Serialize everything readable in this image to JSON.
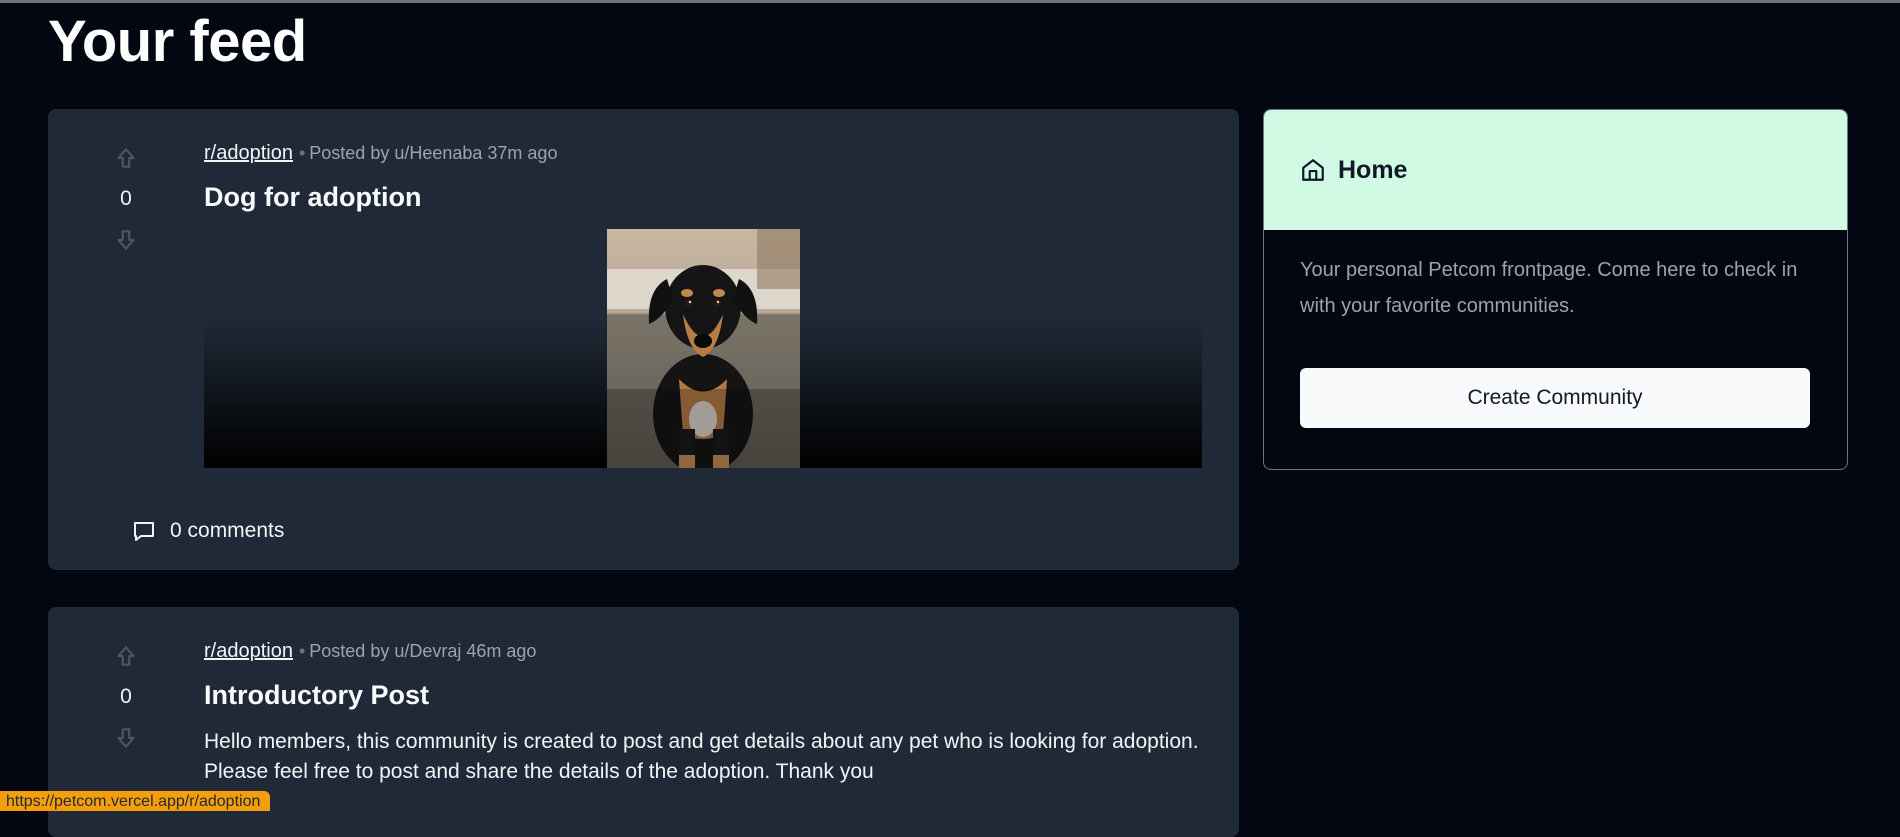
{
  "page": {
    "title": "Your feed"
  },
  "posts": [
    {
      "votes": "0",
      "subreddit": "r/adoption",
      "meta": "Posted by u/Heenaba 37m ago",
      "title": "Dog for adoption",
      "has_image": true,
      "comments": "0 comments"
    },
    {
      "votes": "0",
      "subreddit": "r/adoption",
      "meta": "Posted by u/Devraj 46m ago",
      "title": "Introductory Post",
      "body": "Hello members, this community is created to post and get details about any pet who is looking for adoption. Please feel free to post and share the details of the adoption. Thank you"
    }
  ],
  "sidebar": {
    "title": "Home",
    "icon": "home-icon",
    "description": "Your personal Petcom frontpage. Come here to check in with your favorite communities.",
    "create_button": "Create Community"
  },
  "status_bar": {
    "url": "https://petcom.vercel.app/r/adoption"
  },
  "colors": {
    "background": "#030712",
    "card": "#1f2937",
    "home_header": "#d1fae5",
    "status_url_bg": "#f59e0b"
  }
}
